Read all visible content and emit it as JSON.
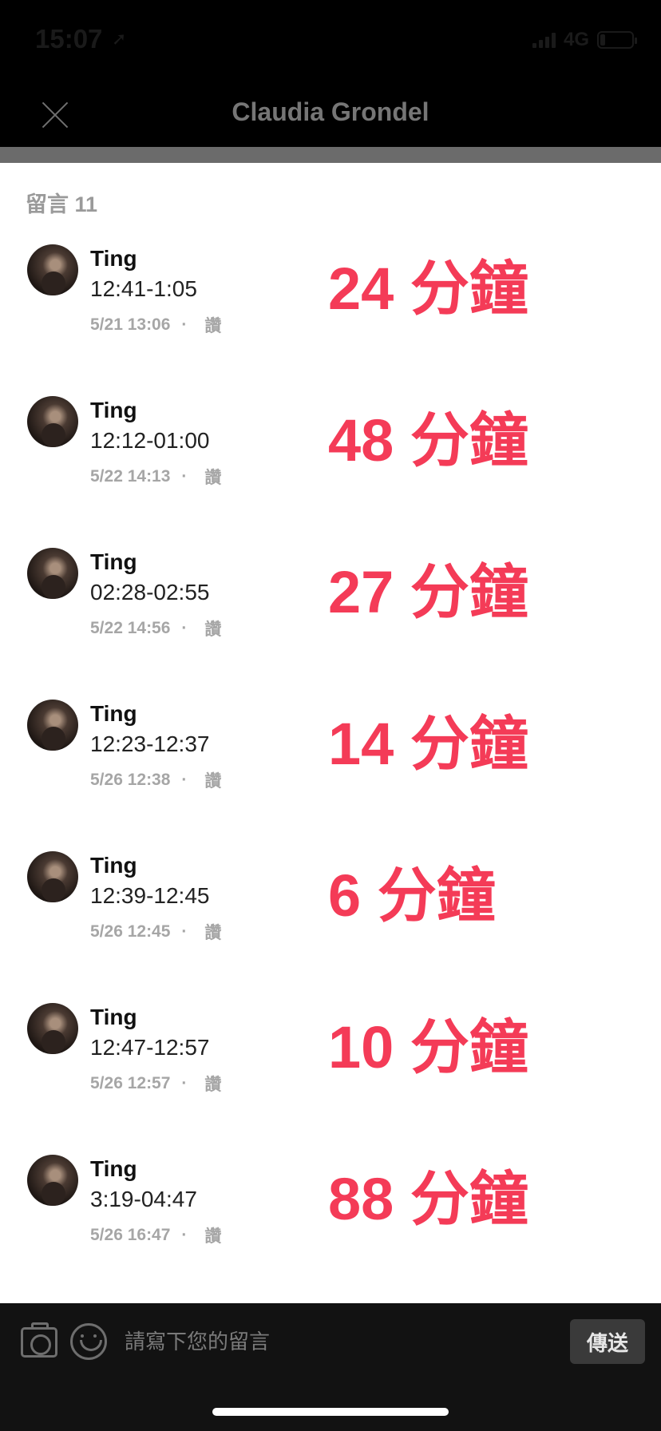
{
  "status_bar": {
    "time": "15:07",
    "location_glyph": "➚",
    "network": "4G",
    "battery_level": 0.15
  },
  "nav": {
    "title": "Claudia Grondel",
    "close_icon": "close-icon"
  },
  "comments_header": {
    "label": "留言 11"
  },
  "comments": [
    {
      "name": "Ting",
      "text": "12:41-1:05",
      "date": "5/21 13:06",
      "separator": "·",
      "like": "讚",
      "mark": "24 分鐘"
    },
    {
      "name": "Ting",
      "text": "12:12-01:00",
      "date": "5/22 14:13",
      "separator": "·",
      "like": "讚",
      "mark": "48 分鐘"
    },
    {
      "name": "Ting",
      "text": "02:28-02:55",
      "date": "5/22 14:56",
      "separator": "·",
      "like": "讚",
      "mark": "27 分鐘"
    },
    {
      "name": "Ting",
      "text": "12:23-12:37",
      "date": "5/26 12:38",
      "separator": "·",
      "like": "讚",
      "mark": "14 分鐘"
    },
    {
      "name": "Ting",
      "text": "12:39-12:45",
      "date": "5/26 12:45",
      "separator": "·",
      "like": "讚",
      "mark": "6 分鐘"
    },
    {
      "name": "Ting",
      "text": "12:47-12:57",
      "date": "5/26 12:57",
      "separator": "·",
      "like": "讚",
      "mark": "10 分鐘"
    },
    {
      "name": "Ting",
      "text": "3:19-04:47",
      "date": "5/26 16:47",
      "separator": "·",
      "like": "讚",
      "mark": "88 分鐘"
    }
  ],
  "composer": {
    "placeholder": "請寫下您的留言",
    "send_label": "傳送",
    "camera_icon": "camera-icon",
    "emoji_icon": "smile-icon"
  },
  "colors": {
    "annotation_red": "#f43b57",
    "header_bg": "#000000",
    "composer_bg": "#121212"
  }
}
